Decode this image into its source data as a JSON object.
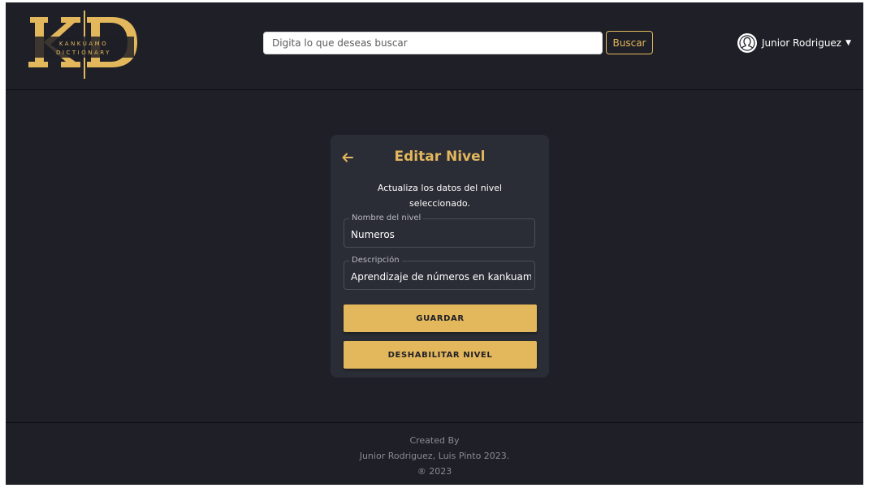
{
  "header": {
    "logo": {
      "letters": "KD",
      "line1": "KANKUAMO",
      "line2": "DICTIONARY"
    },
    "search": {
      "placeholder": "Digita lo que deseas buscar",
      "button_label": "Buscar"
    },
    "user": {
      "name": "Junior Rodriguez",
      "icon": "user-avatar-icon"
    }
  },
  "card": {
    "title": "Editar Nivel",
    "subtitle": "Actualiza los datos del nivel seleccionado.",
    "back_icon": "arrow-left-icon",
    "fields": [
      {
        "label": "Nombre del nivel",
        "value": "Numeros"
      },
      {
        "label": "Descripción",
        "value": "Aprendizaje de números en kankuamo"
      }
    ],
    "save_label": "GUARDAR",
    "disable_label": "DESHABILITAR NIVEL"
  },
  "footer": {
    "created_by": "Created By",
    "authors": "Junior Rodriguez, Luis Pinto 2023.",
    "copyright": "® 2023"
  },
  "colors": {
    "background": "#1f2027",
    "card": "#2b2d36",
    "accent": "#e3b75c"
  }
}
